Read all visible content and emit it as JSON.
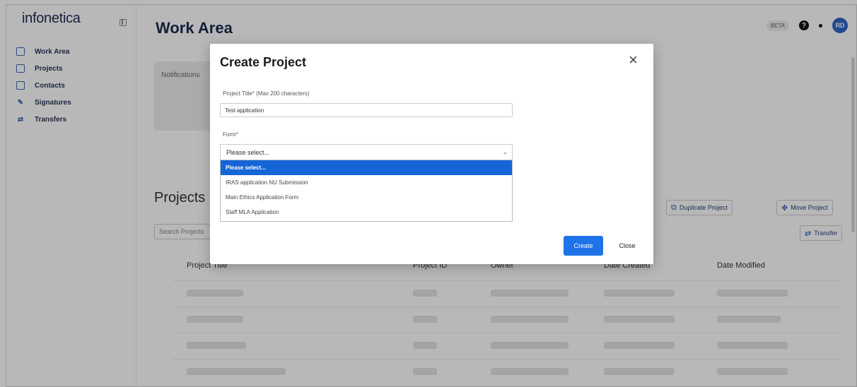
{
  "app": {
    "logo": "infonetica"
  },
  "sidebar": {
    "items": [
      {
        "label": "Work Area",
        "icon": "work-area-icon"
      },
      {
        "label": "Projects",
        "icon": "projects-icon"
      },
      {
        "label": "Contacts",
        "icon": "contacts-icon"
      },
      {
        "label": "Signatures",
        "icon": "signatures-icon"
      },
      {
        "label": "Transfers",
        "icon": "transfers-icon"
      }
    ]
  },
  "header": {
    "title": "Work Area",
    "beta": "BETA",
    "help": "?",
    "avatar": "RD"
  },
  "notifications": {
    "label": "Notifications"
  },
  "projects": {
    "title": "Projects",
    "search_placeholder": "Search Projects",
    "buttons": {
      "duplicate": "Duplicate Project",
      "move": "Move Project",
      "transfer": "Transfer"
    },
    "columns": [
      "Project Title",
      "Project ID",
      "Owner",
      "Date Created",
      "Date Modified"
    ]
  },
  "modal": {
    "title": "Create Project",
    "close_glyph": "×",
    "project_title_label": "Project Title* (Max 200 characters)",
    "project_title_value": "Test application",
    "form_label": "Form*",
    "form_selected": "Please select...",
    "form_options": [
      "Please select...",
      "IRAS application NU Submission",
      "Main Ethics Application Form",
      "Staff MLA Application"
    ],
    "create_label": "Create",
    "close_label": "Close"
  },
  "colors": {
    "accent": "#1e73e8",
    "selected_option": "#1565d8",
    "brand": "#1f2d57"
  }
}
